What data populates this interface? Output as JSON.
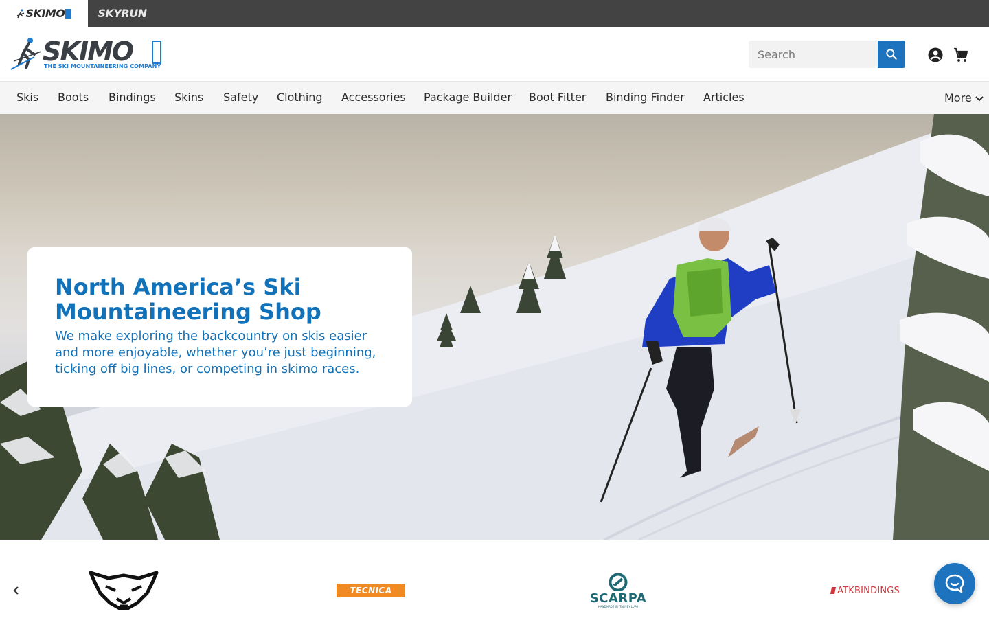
{
  "brand_bar": {
    "skimo": {
      "brand": "SKIMO",
      "suffix": "CO"
    },
    "skyrun": "SKYRUN"
  },
  "header": {
    "logo_word": "SKIMO",
    "logo_tagline": "THE SKI MOUNTAINEERING COMPANY",
    "search": {
      "placeholder": "Search",
      "value": ""
    }
  },
  "nav": {
    "items": [
      "Skis",
      "Boots",
      "Bindings",
      "Skins",
      "Safety",
      "Clothing",
      "Accessories",
      "Package Builder",
      "Boot Fitter",
      "Binding Finder",
      "Articles"
    ],
    "more_label": "More"
  },
  "hero": {
    "title": "North America’s Ski Mountaineering Shop",
    "text": "We make exploring the backcountry on skis easier and more enjoyable, whether you’re just beginning, ticking off big lines, or competing in skimo races."
  },
  "brands": {
    "logos": [
      {
        "name": "Dynafit",
        "icon": "snow-leopard-icon"
      },
      {
        "name": "Tecnica",
        "text": "TECNICA"
      },
      {
        "name": "Scarpa",
        "text": "SCARPA",
        "subtext": "HANDMADE IN ITALY BY LUPO"
      },
      {
        "name": "ATK Bindings",
        "text": "ATKBINDINGS"
      }
    ]
  },
  "colors": {
    "accent": "#1e73be",
    "hero_text": "#1171b9",
    "brand_bar": "#434343",
    "tecnica": "#f08a24",
    "scarpa": "#1e6a74",
    "atk": "#d0363a"
  }
}
